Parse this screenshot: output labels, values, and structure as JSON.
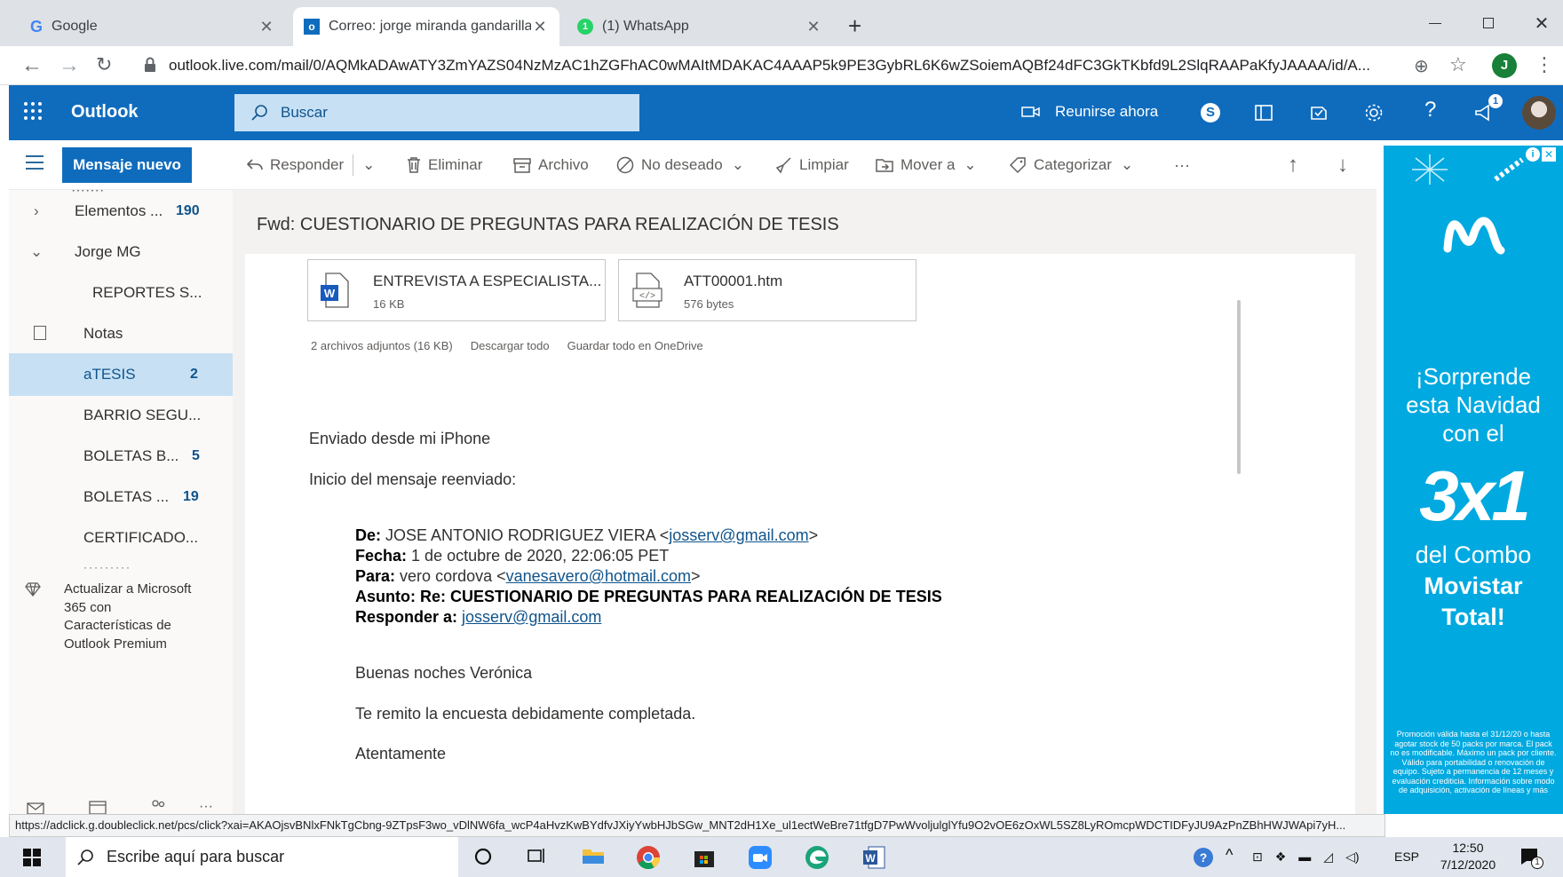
{
  "browser": {
    "tabs": [
      {
        "title": "Google",
        "icon": "google-icon"
      },
      {
        "title": "Correo: jorge miranda gandarilla",
        "icon": "outlook-icon"
      },
      {
        "title": "(1) WhatsApp",
        "icon": "whatsapp-icon"
      }
    ],
    "url": "outlook.live.com/mail/0/AQMkADAwATY3ZmYAZS04NzMzAC1hZGFhAC0wMAItMDAKAC4AAAP5k9PE3GybRL6K6wZSoiemAQBf24dFC3GkTKbfd9L2SlqRAAPaKfyJAAAA/id/A...",
    "profile_initial": "J"
  },
  "outlook": {
    "app_name": "Outlook",
    "search_placeholder": "Buscar",
    "meet_now": "Reunirse ahora",
    "notif_count": "1",
    "new_message": "Mensaje nuevo",
    "toolbar": {
      "reply": "Responder",
      "delete": "Eliminar",
      "archive": "Archivo",
      "junk": "No deseado",
      "sweep": "Limpiar",
      "move": "Mover a",
      "categorize": "Categorizar",
      "more": "···"
    },
    "folders": [
      {
        "label": "Elementos ...",
        "count": "190"
      },
      {
        "label": "Jorge MG",
        "count": ""
      },
      {
        "label": "REPORTES S...",
        "count": ""
      },
      {
        "label": "Notas",
        "count": ""
      },
      {
        "label": "aTESIS",
        "count": "2"
      },
      {
        "label": "BARRIO SEGU...",
        "count": ""
      },
      {
        "label": "BOLETAS B...",
        "count": "5"
      },
      {
        "label": "BOLETAS ...",
        "count": "19"
      },
      {
        "label": "CERTIFICADO...",
        "count": ""
      }
    ],
    "upgrade_text": "Actualizar a Microsoft 365 con Características de Outlook Premium"
  },
  "email": {
    "subject": "Fwd: CUESTIONARIO DE PREGUNTAS PARA REALIZACIÓN DE TESIS",
    "attachments": [
      {
        "name": "ENTREVISTA A ESPECIALISTA...",
        "size": "16 KB",
        "icon": "word-file-icon"
      },
      {
        "name": "ATT00001.htm",
        "size": "576 bytes",
        "icon": "html-file-icon"
      }
    ],
    "attach_summary": "2 archivos adjuntos (16 KB)",
    "download_all": "Descargar todo",
    "save_onedrive": "Guardar todo en OneDrive",
    "sent_from": "Enviado desde mi iPhone",
    "forward_start": "Inicio del mensaje reenviado:",
    "from_label": "De:",
    "from_name": "JOSE ANTONIO RODRIGUEZ VIERA <",
    "from_email": "josserv@gmail.com",
    "date_label": "Fecha:",
    "date_value": "1 de octubre de 2020, 22:06:05 PET",
    "to_label": "Para:",
    "to_name": "vero cordova <",
    "to_email": "vanesavero@hotmail.com",
    "subj_label": "Asunto:",
    "subj_value": "Re: CUESTIONARIO DE PREGUNTAS PARA REALIZACIÓN DE TESIS",
    "replyto_label": "Responder a:",
    "replyto_email": "josserv@gmail.com",
    "greeting": "Buenas noches Verónica",
    "line1": "Te remito la encuesta debidamente completada.",
    "closing": "Atentamente"
  },
  "ad": {
    "line1": "¡Sorprende",
    "line2": "esta Navidad",
    "line3": "con el",
    "big": "3x1",
    "line4": "del Combo",
    "line5": "Movistar",
    "line6": "Total!",
    "fine_print": "Promoción válida hasta el 31/12/20 o hasta agotar stock de 50 packs por marca. El pack no es modificable. Máximo un pack por cliente. Válido para portabilidad o renovación de equipo. Sujeto a permanencia de 12 meses y evaluación crediticia. Información sobre modo de adquisición, activación de líneas y más"
  },
  "status_url": "https://adclick.g.doubleclick.net/pcs/click?xai=AKAOjsvBNlxFNkTgCbng-9ZTpsF3wo_vDlNW6fa_wcP4aHvzKwBYdfvJXiyYwbHJbSGw_MNT2dH1Xe_ul1ectWeBre71tfgD7PwWvoljulglYfu9O2vOE6zOxWL5SZ8LyROmcpWDCTIDFyJU9AzPnZBhHWJWApi7yH...",
  "taskbar": {
    "search_placeholder": "Escribe aquí para buscar",
    "lang": "ESP",
    "time": "12:50",
    "date": "7/12/2020",
    "notif": "1"
  }
}
